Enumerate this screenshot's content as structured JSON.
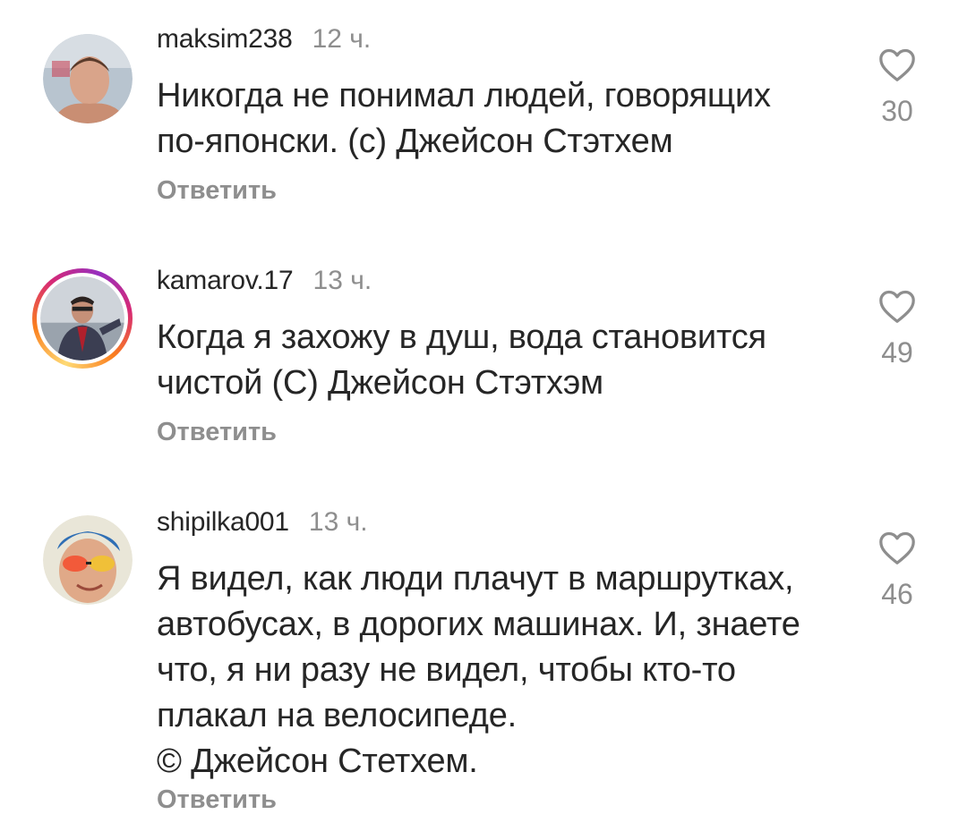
{
  "comments": [
    {
      "username": "maksim238",
      "time": "12 ч.",
      "lines": [
        "Никогда не понимал людей, говорящих",
        "по-японски. (с) Джейсон Стэтхем"
      ],
      "reply_label": "Ответить",
      "likes": "30",
      "icon": "heart-outline-icon",
      "has_story_ring": false
    },
    {
      "username": "kamarov.17",
      "time": "13 ч.",
      "lines": [
        "Когда я захожу в душ, вода становится",
        "чистой (С) Джейсон Стэтхэм"
      ],
      "reply_label": "Ответить",
      "likes": "49",
      "icon": "heart-outline-icon",
      "has_story_ring": true
    },
    {
      "username": "shipilka001",
      "time": "13 ч.",
      "lines": [
        "Я видел, как люди плачут в маршрутках,",
        "автобусах, в дорогих машинах. И, знаете",
        "что, я ни разу не видел, чтобы кто-то",
        "плакал на велосипеде.",
        "© Джейсон Стетхем."
      ],
      "reply_label": "Ответить",
      "likes": "46",
      "icon": "heart-outline-icon",
      "has_story_ring": false
    }
  ],
  "colors": {
    "text": "#262626",
    "secondary": "#8e8e8e",
    "background": "#ffffff"
  }
}
